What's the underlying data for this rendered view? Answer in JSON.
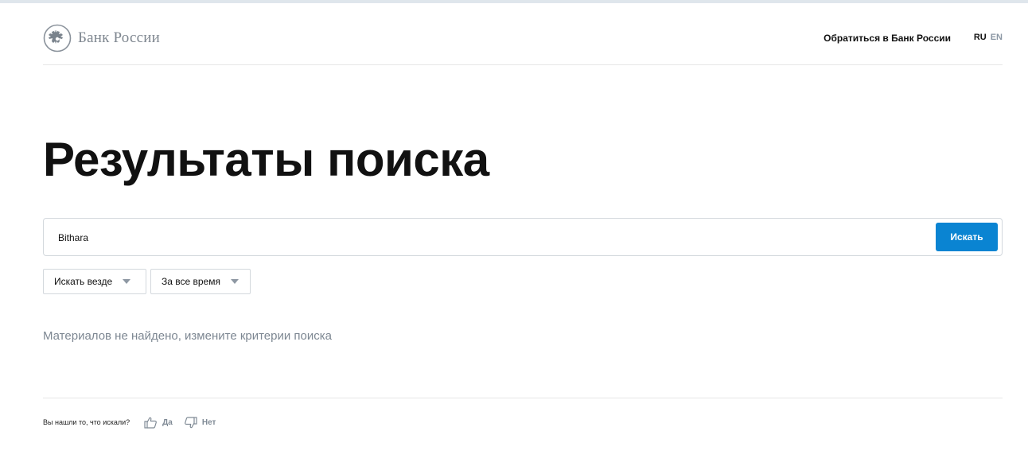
{
  "header": {
    "logo_text": "Банк России",
    "contact_link": "Обратиться в Банк России",
    "lang_ru": "RU",
    "lang_en": "EN"
  },
  "page": {
    "title": "Результаты поиска"
  },
  "search": {
    "value": "Bithara",
    "button_label": "Искать"
  },
  "filters": {
    "where": "Искать везде",
    "time": "За все время"
  },
  "results": {
    "empty_message": "Материалов не найдено, измените критерии поиска"
  },
  "feedback": {
    "question": "Вы нашли то, что искали?",
    "yes": "Да",
    "no": "Нет"
  },
  "colors": {
    "accent": "#0a84d2",
    "muted_text": "#7d8792"
  },
  "icons": {
    "logo": "double-headed-eagle-emblem-icon",
    "filter_caret": "triangle-down-icon",
    "yes": "thumbs-up-icon",
    "no": "thumbs-down-icon"
  }
}
